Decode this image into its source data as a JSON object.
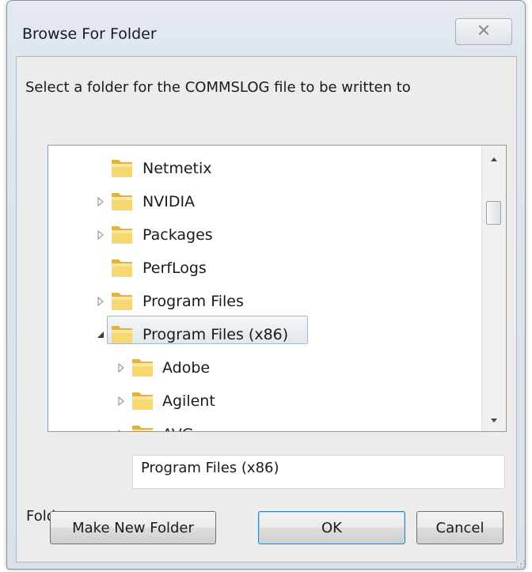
{
  "dialog": {
    "title": "Browse For Folder",
    "close_icon": "close-x-icon",
    "prompt": "Select a folder for the COMMSLOG file to be written to"
  },
  "tree": {
    "items": [
      {
        "label": "Netmetix",
        "level": 0,
        "expander": "none",
        "selected": false
      },
      {
        "label": "NVIDIA",
        "level": 0,
        "expander": "collapsed",
        "selected": false
      },
      {
        "label": "Packages",
        "level": 0,
        "expander": "collapsed",
        "selected": false
      },
      {
        "label": "PerfLogs",
        "level": 0,
        "expander": "none",
        "selected": false
      },
      {
        "label": "Program Files",
        "level": 0,
        "expander": "collapsed",
        "selected": false
      },
      {
        "label": "Program Files (x86)",
        "level": 0,
        "expander": "expanded",
        "selected": true
      },
      {
        "label": "Adobe",
        "level": 1,
        "expander": "collapsed",
        "selected": false
      },
      {
        "label": "Agilent",
        "level": 1,
        "expander": "collapsed",
        "selected": false
      },
      {
        "label": "AVG",
        "level": 1,
        "expander": "collapsed",
        "selected": false
      }
    ],
    "icons": {
      "folder": "folder-icon",
      "collapsed": "triangle-right-icon",
      "expanded": "triangle-down-icon"
    }
  },
  "folder_field": {
    "label": "Folder:",
    "value": "Program Files (x86)"
  },
  "buttons": {
    "make_new_folder": "Make New Folder",
    "ok": "OK",
    "cancel": "Cancel"
  },
  "colors": {
    "folder_yellow": "#f3cd5a",
    "selection_border": "#a7b4c4"
  }
}
